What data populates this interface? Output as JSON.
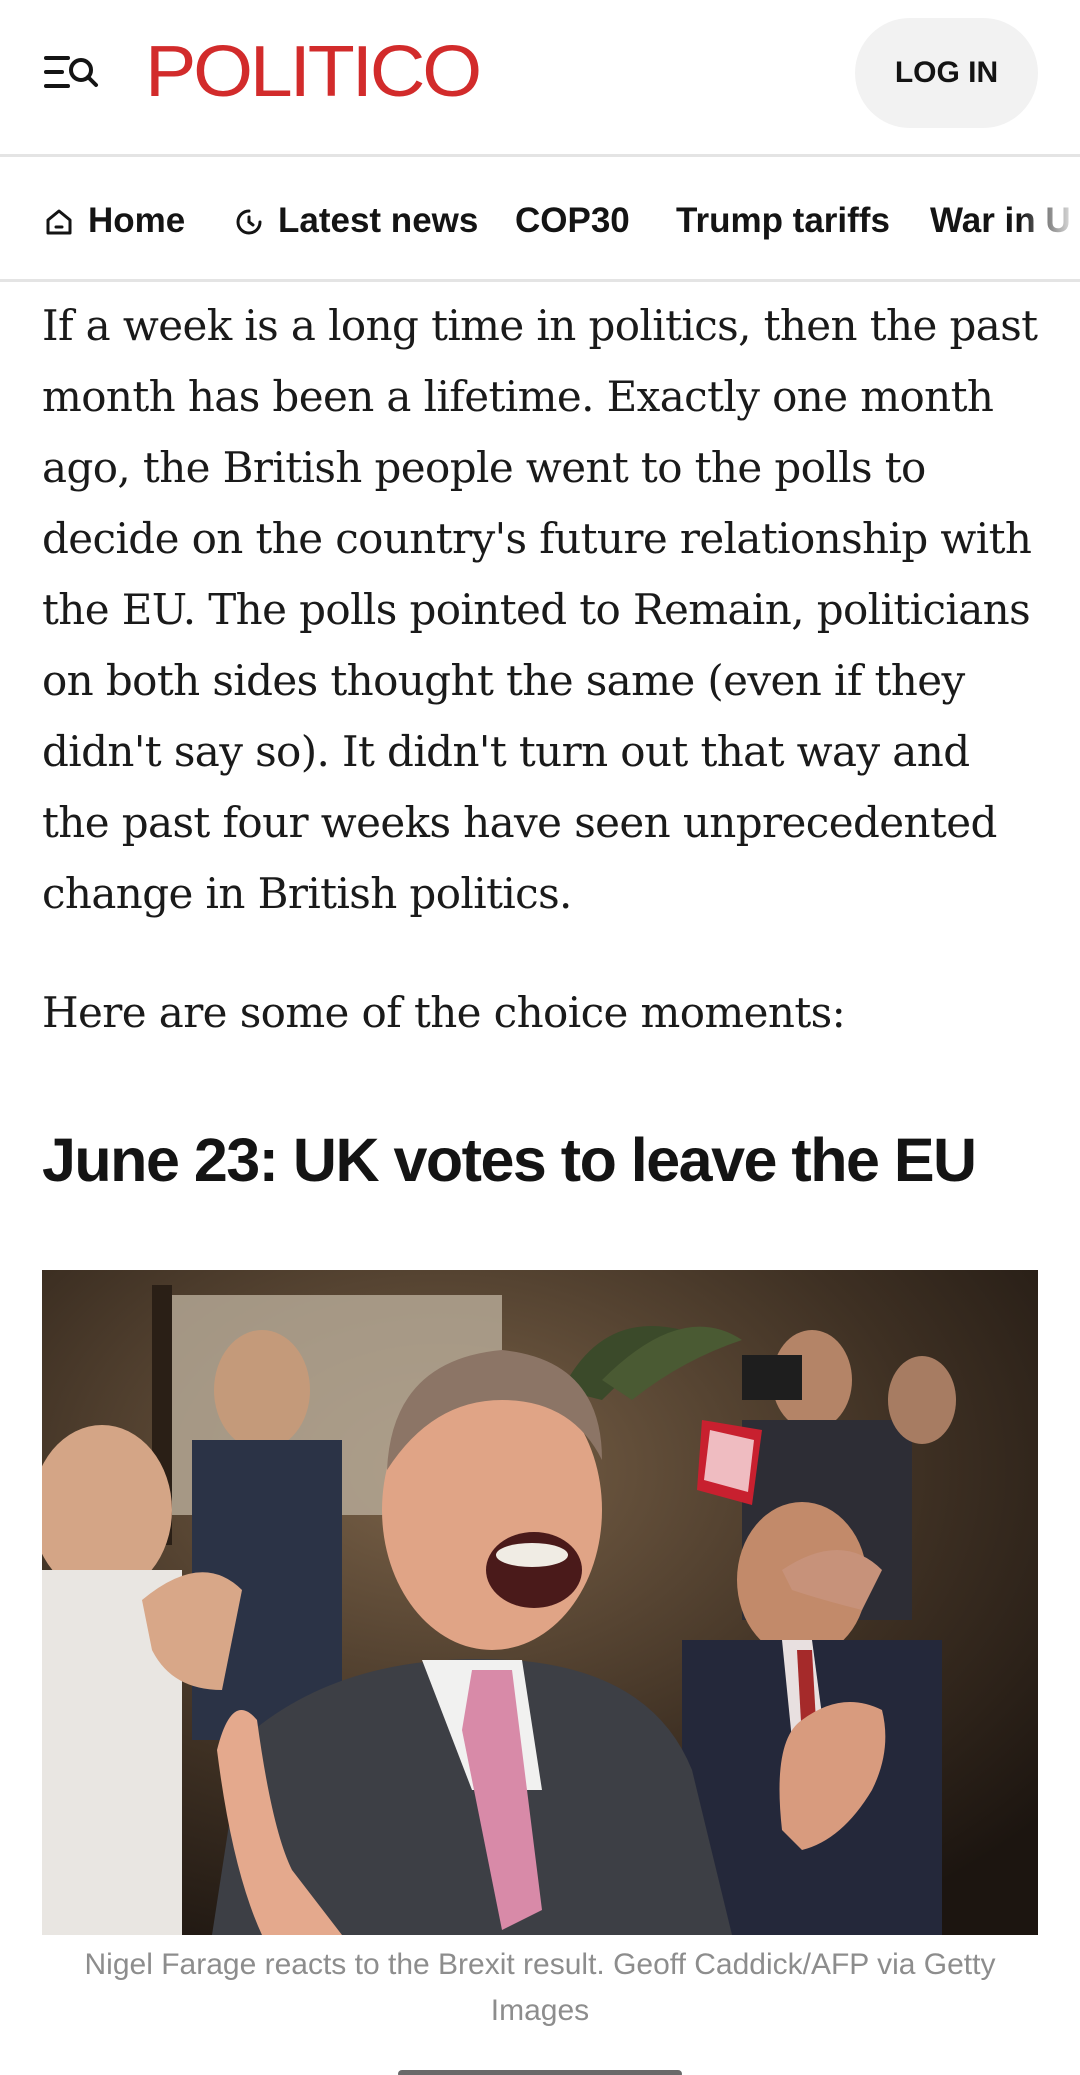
{
  "header": {
    "menu_icon": "menu-search-icon",
    "logo_text": "POLITICO",
    "login_label": "LOG IN",
    "brand_color": "#d22b2b"
  },
  "nav": {
    "items": [
      {
        "label": "Home",
        "icon": "home-icon"
      },
      {
        "label": "Latest news",
        "icon": "clock-icon"
      },
      {
        "label": "COP30"
      },
      {
        "label": "Trump tariffs"
      },
      {
        "label": "War in U"
      }
    ]
  },
  "article": {
    "intro": "If a week is a long time in politics, then the past month has been a lifetime. Exactly one month ago, the British people went to the polls to decide on the country's future relationship with the EU. The polls pointed to Remain, politicians on both sides thought the same (even if they didn't say so). It didn't turn out that way and the past four weeks have seen unprecedented change in British politics.",
    "lead_in": "Here are some of the choice moments:",
    "section_heading": "June 23: UK votes to leave the EU",
    "photo_caption": "Nigel Farage reacts to the Brexit result. Geoff Caddick/AFP via Getty Images"
  }
}
